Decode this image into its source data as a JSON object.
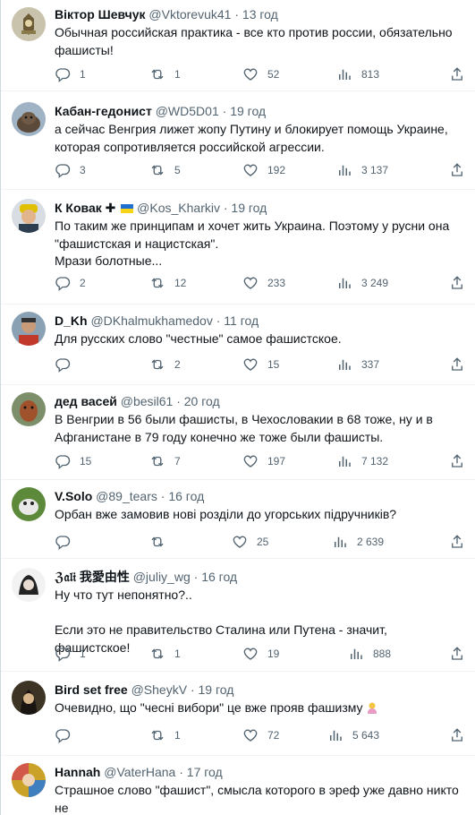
{
  "colors": {
    "text": "#0f1419",
    "secondary": "#536471",
    "divider": "#eff3f4"
  },
  "icons": {
    "reply": "reply-icon",
    "retweet": "retweet-icon",
    "like": "heart-icon",
    "views": "views-icon",
    "share": "share-icon"
  },
  "tweets": [
    {
      "name": "Віктор Шевчук",
      "handle": "@Vktorevuk41",
      "dot": "·",
      "time": "13 год",
      "text": "Обычная российская практика - все кто против россии, обязательно\nфашисты!",
      "replies": "1",
      "retweets": "1",
      "likes": "52",
      "views": "813"
    },
    {
      "name": "Кабан-гедонист",
      "handle": "@WD5D01",
      "dot": "·",
      "time": "19 год",
      "text": "а сейчас Венгрия лижет жопу Путину и блокирует помощь Украине,\nкоторая сопротивляется российской агрессии.",
      "replies": "3",
      "retweets": "5",
      "likes": "192",
      "views": "3 137"
    },
    {
      "name": "К Ковак",
      "name_suffix": "✚",
      "handle": "@Kos_Kharkiv",
      "dot": "·",
      "time": "19 год",
      "text": "По таким же принципам и хочет жить Украина. Поэтому у русни она\n\"фашистская и нацистская\".\nМрази болотные...",
      "replies": "2",
      "retweets": "12",
      "likes": "233",
      "views": "3 249"
    },
    {
      "name": "D_Kh",
      "handle": "@DKhalmukhamedov",
      "dot": "·",
      "time": "11 год",
      "text": "Для русских слово \"честные\" самое фашистское.",
      "replies": "",
      "retweets": "2",
      "likes": "15",
      "views": "337"
    },
    {
      "name": "дед васей",
      "handle": "@besil61",
      "dot": "·",
      "time": "20 год",
      "text": "В Венгрии в 56 были фашисты, в Чехословакии в 68 тоже, ну и в\nАфганистане в 79 году конечно же тоже были фашисты.",
      "replies": "15",
      "retweets": "7",
      "likes": "197",
      "views": "7 132"
    },
    {
      "name": "V.Solo",
      "handle": "@89_tears",
      "dot": "·",
      "time": "16 год",
      "text": "Орбан вже замовив нові розділи до угорських підручників?",
      "replies": "",
      "retweets": "",
      "likes": "25",
      "views": "2 639"
    },
    {
      "name": "ℨ𝔞𝔩𝔦 我愛由性",
      "handle": "@juliy_wg",
      "dot": "·",
      "time": "16 год",
      "text": "Ну что тут непонятно?..\n\nЕсли это не правительство Сталина или Путена - значит, фашистское!",
      "replies": "1",
      "retweets": "1",
      "likes": "19",
      "views": "888"
    },
    {
      "name": "Bird set free",
      "handle": "@SheykV",
      "dot": "·",
      "time": "19 год",
      "text": "Очевидно, що \"чесні вибори\" це вже прояв фашизму",
      "replies": "",
      "retweets": "1",
      "likes": "72",
      "views": "5 643"
    },
    {
      "name": "Hannah",
      "handle": "@VaterHana",
      "dot": "·",
      "time": "17 год",
      "text": "Страшное слово \"фашист\", смысла которого в эреф уже давно никто не\nпонимает, окончательно превратилось в потертый медный грош.",
      "replies": "",
      "retweets": "",
      "likes": "",
      "views": ""
    }
  ]
}
